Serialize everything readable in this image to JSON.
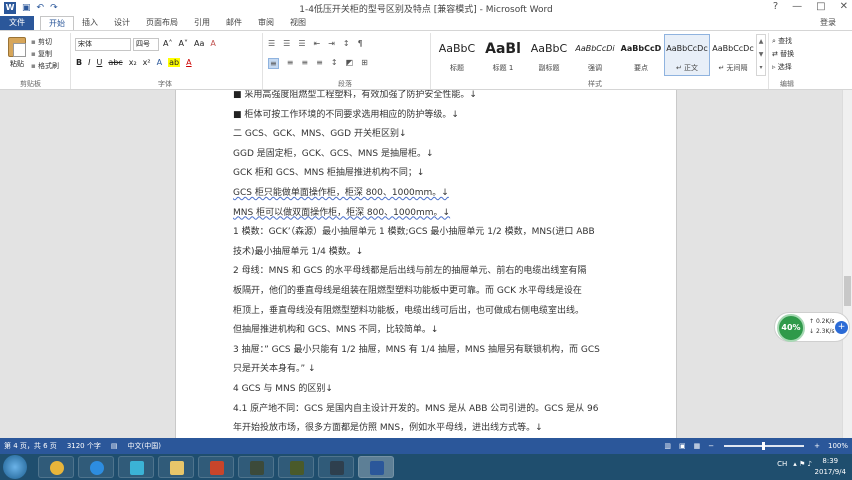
{
  "window": {
    "title": "1-4低压开关柜的型号区别及特点 [兼容模式] - Microsoft Word",
    "app_icon": "W",
    "undo_glyph": "↶",
    "redo_glyph": "↷",
    "help_glyph": "?",
    "min_glyph": "—",
    "max_glyph": "□",
    "close_glyph": "✕",
    "login": "登录"
  },
  "tabs": {
    "file": "文件",
    "items": [
      "开始",
      "插入",
      "设计",
      "页面布局",
      "引用",
      "邮件",
      "审阅",
      "视图"
    ]
  },
  "ribbon": {
    "clipboard": {
      "paste": "粘贴",
      "cut": "剪切",
      "copy": "复制",
      "format_painter": "格式刷",
      "group_label": "剪贴板"
    },
    "font": {
      "font_name": "宋体",
      "font_size": "四号",
      "grow": "A˄",
      "shrink": "A˅",
      "case": "Aa",
      "clear": "A",
      "bold": "B",
      "italic": "I",
      "underline": "U",
      "strike": "abc",
      "sub": "x₂",
      "sup": "x²",
      "font_color": "A",
      "highlight": "ab",
      "effects": "A",
      "group_label": "字体"
    },
    "paragraph": {
      "bullets": "☰",
      "numbering": "☰",
      "multilevel": "☰",
      "decrease_indent": "⇤",
      "increase_indent": "⇥",
      "sort": "↕",
      "show_marks": "¶",
      "align_left": "≡",
      "center": "≡",
      "align_right": "≡",
      "justify": "≡",
      "line_spacing": "↕",
      "shading": "◩",
      "borders": "⊞",
      "group_label": "段落"
    },
    "styles": {
      "items": [
        {
          "sample": "AaBbC",
          "name": "标题"
        },
        {
          "sample": "AaBl",
          "name": "标题 1"
        },
        {
          "sample": "AaBbC",
          "name": "副标题"
        },
        {
          "sample": "AaBbCcDi",
          "name": "强调"
        },
        {
          "sample": "AaBbCcD",
          "name": "要点"
        },
        {
          "sample": "AaBbCcDc",
          "name": "↵ 正文"
        },
        {
          "sample": "AaBbCcDc",
          "name": "↵ 无间隔"
        }
      ],
      "group_label": "样式"
    },
    "editing": {
      "find": "查找",
      "replace": "替换",
      "select": "选择",
      "group_label": "编辑"
    }
  },
  "document": {
    "lines": [
      "采用高强度阻燃型工程塑料，有效加强了防护安全性能。↓",
      "柜体可按工作环境的不同要求选用相应的防护等级。↓",
      "二 GCS、GCK、MNS、GGD 开关柜区别↓",
      "GGD 是固定柜，GCK、GCS、MNS 是抽屉柜。↓",
      "GCK 柜和 GCS、MNS 柜抽屉推进机构不同；↓",
      "GCS 柜只能做单面操作柜，柜深 800、1000mm。↓",
      "MNS 柜可以做双面操作柜，柜深 800、1000mm。↓",
      "1 模数：GCK’（森源）最小抽屉单元 1 模数;GCS 最小抽屉单元 1/2 模数，MNS(进口 ABB",
      "技术)最小抽屉单元 1/4 模数。↓",
      "2 母线：MNS 和 GCS 的水平母线都是后出线与前左的抽屉单元、前右的电缆出线室有隔",
      "板隔开，他们的垂直母线是组装在阻燃型塑料功能板中更可靠。而 GCK 水平母线是设在",
      "柜顶上，垂直母线没有阻燃型塑料功能板，电缆出线可后出，也可做成右侧电缆室出线。",
      "但抽屉推进机构和 GCS、MNS 不同，比较简单。↓",
      "3 抽屉：” GCS 最小只能有 1/2 抽屉，MNS 有 1/4 抽屉，MNS 抽屉另有联锁机构，而 GCS",
      "只是开关本身有。” ↓",
      "4 GCS 与 MNS 的区别↓",
      "4.1 原产地不同：GCS 是国内自主设计开发的。MNS 是从 ABB 公司引进的。GCS 是从 96",
      "年开始投放市场，很多方面都是仿照 MNS，例如水平母线，进出线方式等。↓"
    ]
  },
  "network_widget": {
    "percent": "40%",
    "up": "0.2K/s",
    "down": "2.3K/s",
    "plus": "+"
  },
  "statusbar": {
    "page": "第 4 页，共 6 页",
    "words": "3120 个字",
    "language": "中文(中国)",
    "zoom": "100%",
    "zoom_minus": "−",
    "zoom_plus": "+"
  },
  "taskbar": {
    "tray_text": "CH",
    "time": "8:39",
    "date": "2017/9/4"
  },
  "colors": {
    "brand": "#2b579a",
    "taskbar": "#1f4e6e",
    "network_green": "#2f9a4a"
  }
}
